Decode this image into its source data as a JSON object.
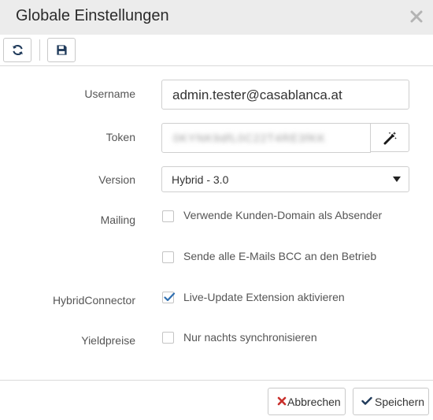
{
  "dialog": {
    "title": "Globale Einstellungen",
    "close_icon": "close-icon"
  },
  "toolbar": {
    "refresh_icon": "refresh-icon",
    "save_icon": "floppy-disk-icon"
  },
  "form": {
    "username": {
      "label": "Username",
      "value": "admin.tester@casablanca.at"
    },
    "token": {
      "label": "Token",
      "value": "0KYNK9dfL0C22T4RE3fKK",
      "generate_icon": "magic-wand-icon"
    },
    "version": {
      "label": "Version",
      "selected": "Hybrid - 3.0"
    },
    "mailing": {
      "label": "Mailing",
      "options": [
        {
          "label": "Verwende Kunden-Domain als Absender",
          "checked": false
        },
        {
          "label": "Sende alle E-Mails BCC an den Betrieb",
          "checked": false
        }
      ]
    },
    "hybrid_connector": {
      "label": "HybridConnector",
      "option": {
        "label": "Live-Update Extension aktivieren",
        "checked": true
      }
    },
    "yieldpreise": {
      "label": "Yieldpreise",
      "option": {
        "label": "Nur nachts synchronisieren",
        "checked": false
      }
    }
  },
  "footer": {
    "cancel_label": "Abbrechen",
    "save_label": "Speichern"
  },
  "colors": {
    "titlebar_bg": "#ececec",
    "check_blue": "#2f6fb0",
    "cancel_red": "#c9302c"
  }
}
